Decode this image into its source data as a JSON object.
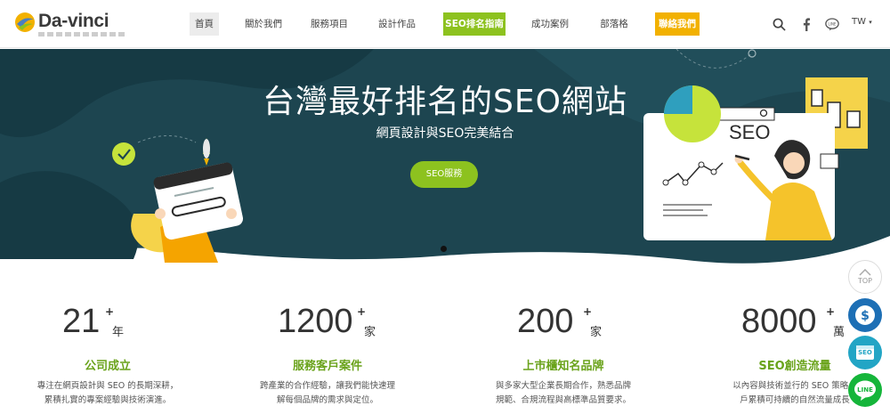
{
  "header": {
    "logo_text": "Da-vinci",
    "nav": [
      {
        "label": "首頁",
        "style": "active"
      },
      {
        "label": "關於我們",
        "style": "normal"
      },
      {
        "label": "服務項目",
        "style": "normal"
      },
      {
        "label": "設計作品",
        "style": "normal"
      },
      {
        "label": "SEO排名指南",
        "style": "green"
      },
      {
        "label": "成功案例",
        "style": "normal"
      },
      {
        "label": "部落格",
        "style": "normal"
      },
      {
        "label": "聯絡我們",
        "style": "orange"
      }
    ],
    "icons": [
      "search-icon",
      "facebook-icon",
      "line-icon"
    ],
    "language": "TW"
  },
  "hero": {
    "title": "台灣最好排名的SEO網站",
    "subtitle": "網頁設計與SEO完美結合",
    "button_label": "SEO服務",
    "illustration_text": "SEO"
  },
  "stats": [
    {
      "number": "21",
      "plus": "+",
      "unit": "年",
      "title": "公司成立",
      "desc1": "專注在網頁設計與 SEO 的長期深耕，",
      "desc2": "累積扎實的專案經驗與技術演進。"
    },
    {
      "number": "1200",
      "plus": "+",
      "unit": "家",
      "title": "服務客戶案件",
      "desc1": "跨產業的合作經驗，讓我們能快速理",
      "desc2": "解每個品牌的需求與定位。"
    },
    {
      "number": "200",
      "plus": "+",
      "unit": "家",
      "title": "上市櫃知名品牌",
      "desc1": "與多家大型企業長期合作，熟悉品牌",
      "desc2": "規範、合規流程與高標準品質要求。"
    },
    {
      "number": "8000",
      "plus": "+",
      "unit": "萬",
      "title": "SEO創造流量",
      "desc1": "以內容與技術並行的 SEO 策略，",
      "desc2": "戶累積可持續的自然流量成長"
    }
  ],
  "floating": {
    "top_label": "TOP",
    "seo_label": "SEO",
    "line_label": "LINE"
  },
  "colors": {
    "brand_green": "#8dc21f",
    "brand_orange": "#f2b100",
    "hero_bg": "#1d4550",
    "stat_title": "#6aa31b",
    "float_blue": "#1d6fb5",
    "float_teal": "#22a5c5",
    "float_line": "#15b53a"
  }
}
